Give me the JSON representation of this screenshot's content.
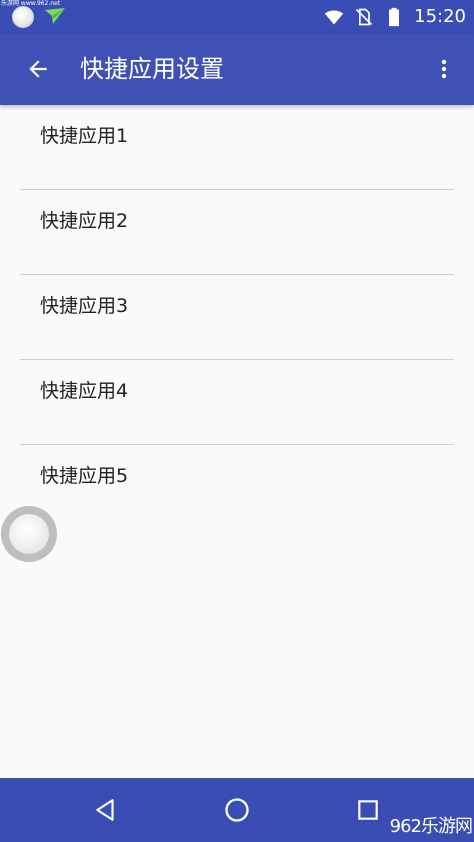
{
  "status_bar": {
    "watermark": "乐游网 www.962.net",
    "time": "15:20",
    "icons": [
      "floating-dot-icon",
      "paper-plane-icon",
      "wifi-icon",
      "no-sim-icon",
      "battery-icon"
    ]
  },
  "app_bar": {
    "title": "快捷应用设置",
    "back_icon": "arrow-left-icon",
    "menu_icon": "more-vert-icon"
  },
  "list": {
    "items": [
      {
        "label": "快捷应用1"
      },
      {
        "label": "快捷应用2"
      },
      {
        "label": "快捷应用3"
      },
      {
        "label": "快捷应用4"
      },
      {
        "label": "快捷应用5"
      }
    ]
  },
  "floating_ball": {
    "icon": "assistive-touch-icon"
  },
  "nav_bar": {
    "icons": [
      "back-triangle-icon",
      "home-circle-icon",
      "recent-square-icon"
    ],
    "watermark": "962乐游网"
  },
  "colors": {
    "primary": "#3f51b5",
    "primary_dark": "#3a4db4",
    "background": "#fafafa",
    "text": "#212121",
    "divider": "#cfcfcf"
  }
}
